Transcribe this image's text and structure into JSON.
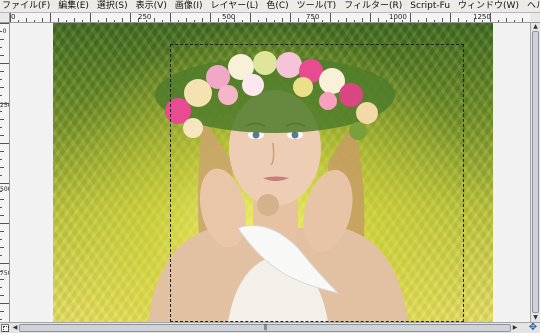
{
  "menubar": {
    "items": [
      {
        "label": "ファイル(F)"
      },
      {
        "label": "編集(E)"
      },
      {
        "label": "選択(S)"
      },
      {
        "label": "表示(V)"
      },
      {
        "label": "画像(I)"
      },
      {
        "label": "レイヤー(L)"
      },
      {
        "label": "色(C)"
      },
      {
        "label": "ツール(T)"
      },
      {
        "label": "フィルター(R)"
      },
      {
        "label": "Script-Fu"
      },
      {
        "label": "ウィンドウ(W)"
      },
      {
        "label": "ヘルプ(H)"
      }
    ]
  },
  "ruler": {
    "top_labels": [
      "0",
      "250",
      "500",
      "750",
      "1000",
      "1250"
    ],
    "left_labels": [
      "0",
      "250",
      "500",
      "750"
    ]
  },
  "icons": {
    "quick_mask": "quick-mask-icon",
    "navigate": "navigate-icon",
    "hscroll_grip": "grip-icon"
  },
  "canvas": {
    "image_subject": "portrait",
    "background_color": "#f2f2f2"
  },
  "scrollbars": {
    "grip": "|||"
  }
}
